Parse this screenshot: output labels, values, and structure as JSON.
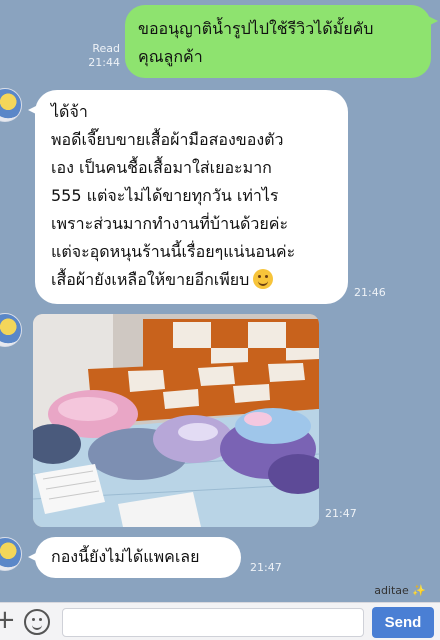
{
  "outgoing": {
    "lines": [
      "ขออนุญาติน้ำรูปไปใช้รีวิวได้มั้ยคับ",
      "คุณลูกค้า"
    ],
    "read_label": "Read",
    "time": "21:44"
  },
  "incoming": [
    {
      "lines": [
        "ได้จ้า",
        "พอดีเจี๊ยบขายเสื้อผ้ามือสองของตัว",
        "เอง เป็นคนชื้อเสื้อมาใส่เยอะมาก",
        "555 แต่จะไม่ได้ขายทุกวัน เท่าไร",
        "เพราะส่วนมากทำงานที่บ้านด้วยค่ะ",
        "แต่จะอุดหนุนร้านนี้เรื่อยๆแน่นอนค่ะ",
        "เสื้อผ้ายังเหลือให้ขายอีกเพียบ"
      ],
      "emoji": "grinning-emoji",
      "time": "21:46"
    },
    {
      "photo": "clothes-pile-photo",
      "time": "21:47"
    },
    {
      "text": "กองนี้ยังไม่ได้แพคเลย",
      "time": "21:47"
    }
  ],
  "watermark": "aditae ✨",
  "composer": {
    "placeholder": "",
    "send_label": "Send"
  },
  "colors": {
    "background": "#8aa3bf",
    "outgoing_bubble": "#8ee36f",
    "incoming_bubble": "#ffffff",
    "send_button": "#4a7fd4"
  },
  "icons": {
    "plus": "plus-icon",
    "emoji": "emoji-icon"
  }
}
